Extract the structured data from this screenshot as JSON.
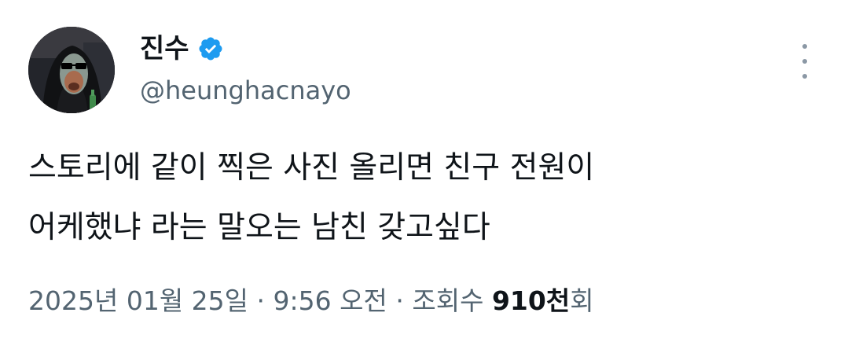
{
  "author": {
    "display_name": "진수",
    "handle": "@heunghacnayo",
    "verified": true,
    "avatar_icon": "profile-avatar-icon",
    "badge_color": "#1d9bf0"
  },
  "tweet": {
    "lines": [
      "스토리에 같이 찍은 사진 올리면 친구 전원이",
      "어케했냐 라는 말오는 남친 갖고싶다"
    ]
  },
  "meta": {
    "date": "2025년 01월 25일",
    "separator": "·",
    "time": "9:56 오전",
    "views_label": "조회수",
    "views_count": "910천",
    "views_suffix": "회"
  },
  "more_icon": "more-vertical-icon"
}
